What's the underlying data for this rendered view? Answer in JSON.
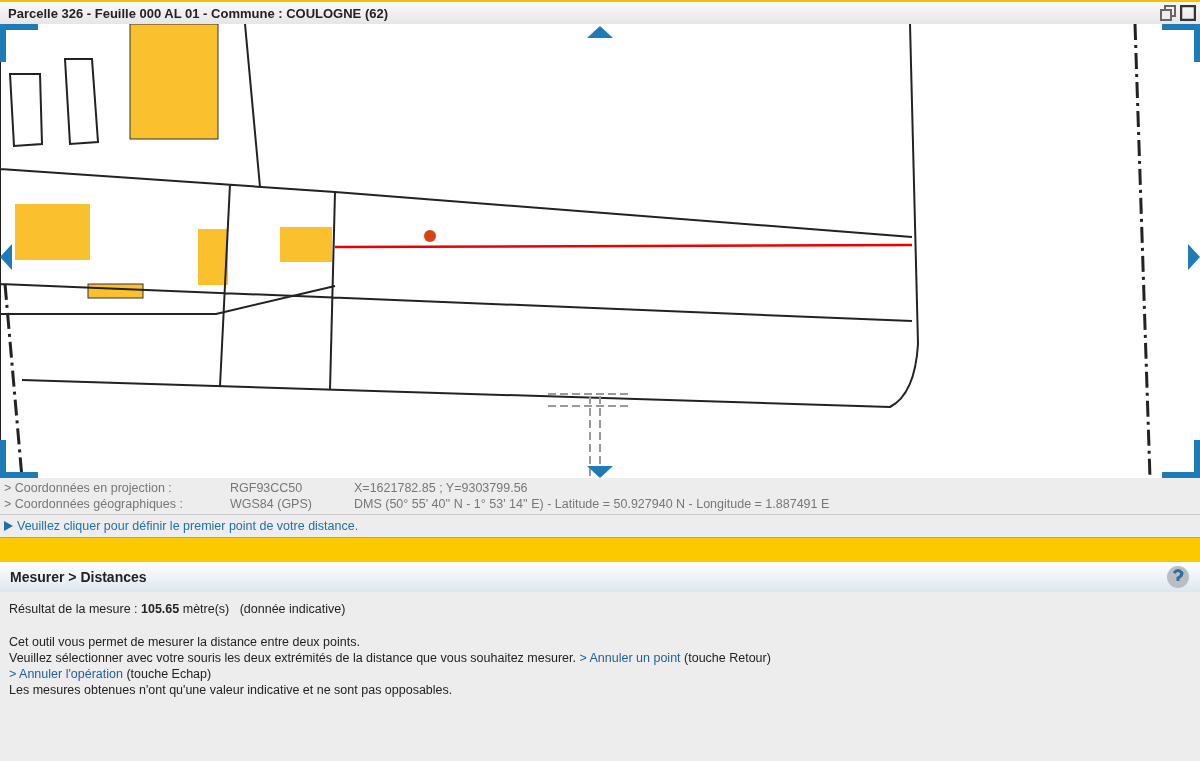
{
  "title_bar": {
    "title": "Parcelle 326 - Feuille 000 AL 01 - Commune : COULOGNE (62)"
  },
  "coordinates": [
    {
      "label": "> Coordonnées en projection :",
      "system": "RGF93CC50",
      "value": "X=1621782.85 ; Y=9303799.56"
    },
    {
      "label": "> Coordonnées géographiques :",
      "system": "WGS84 (GPS)",
      "value": "DMS (50° 55' 40'' N - 1° 53' 14'' E) - Latitude = 50.927940 N - Longitude = 1.887491 E"
    }
  ],
  "instruction": "Veuillez cliquer pour définir le premier point de votre distance.",
  "panel": {
    "breadcrumb": "Mesurer > Distances",
    "result": "Résultat de la mesure : **105.65** mètre(s)   (donnée indicative)",
    "help": {
      "intro": "Cet outil vous permet de mesurer la distance entre deux points.",
      "select_text": "Veuillez sélectionner avec votre souris les deux extrémités de la distance que vous souhaitez mesurer.",
      "undo_point_link": "> Annuler un point",
      "undo_point_key": "(touche Retour)",
      "cancel_link": "> Annuler l'opération",
      "cancel_key": "(touche Echap)",
      "disclaimer": "Les mesures obtenues n'ont qu'une valeur indicative et ne sont pas opposables."
    }
  }
}
